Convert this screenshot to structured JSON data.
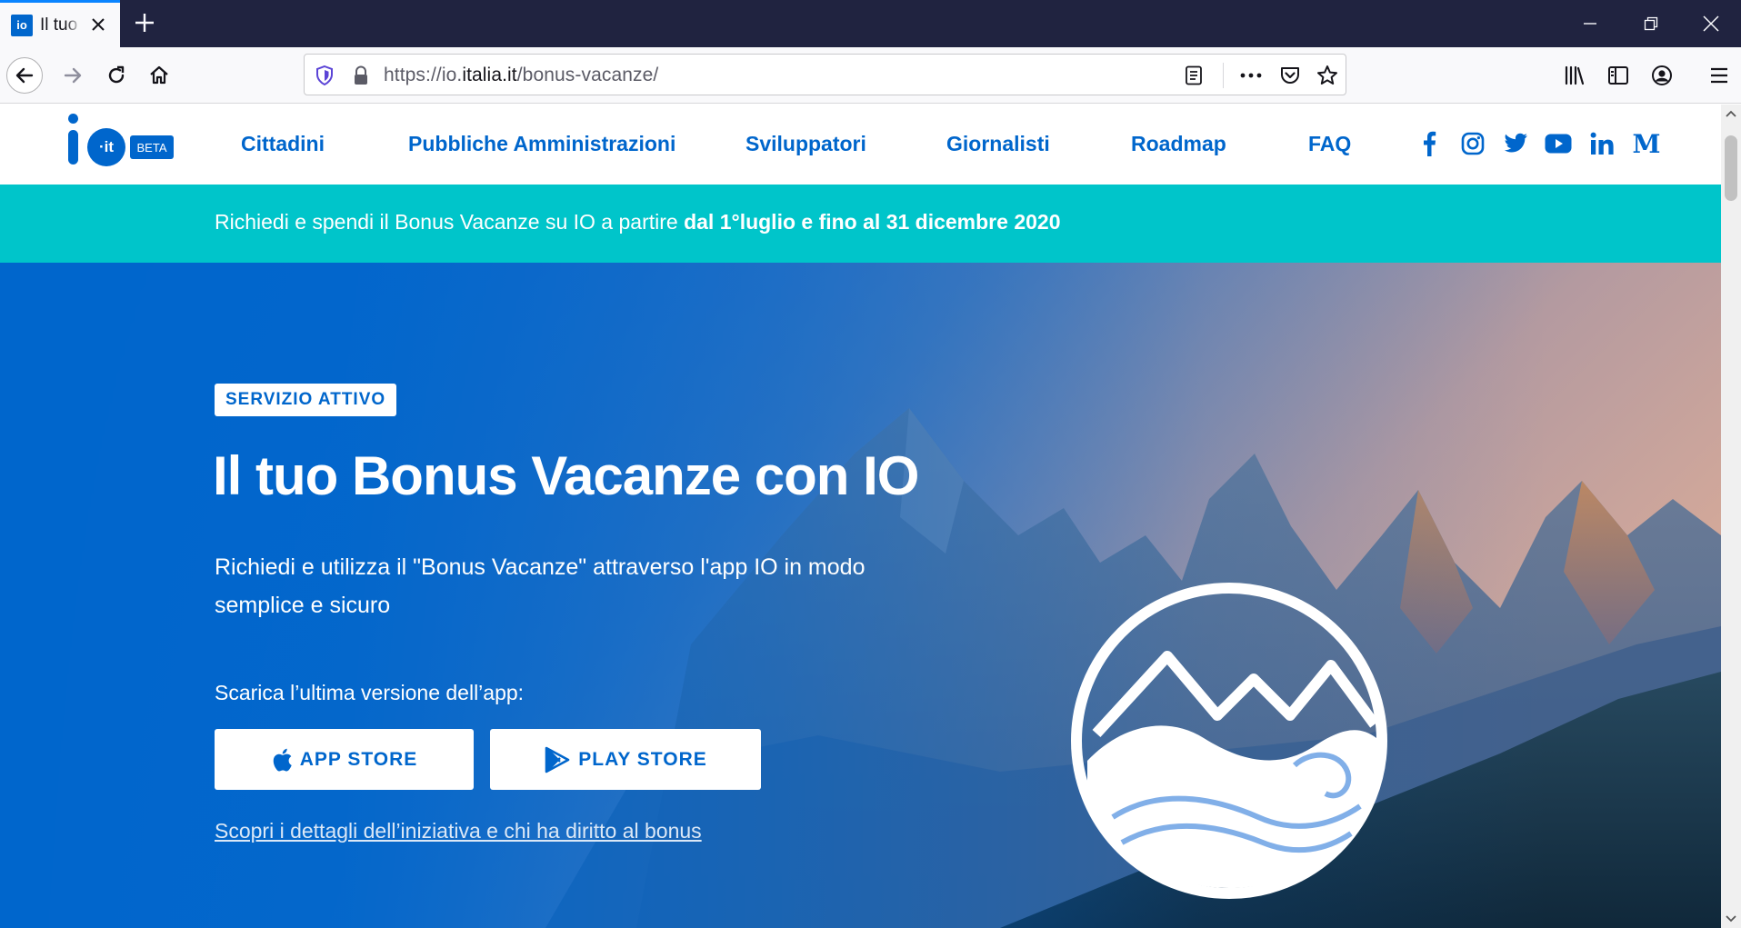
{
  "browser": {
    "tab_title": "Il tuo Bonus Vacanze con IO",
    "tab_favicon_text": "io",
    "url_prefix": "https://io.",
    "url_domain": "italia.it",
    "url_path": "/bonus-vacanze/"
  },
  "site": {
    "logo": {
      "letter": "i",
      "it_text": "·it",
      "beta_label": "BETA"
    },
    "nav": [
      {
        "label": "Cittadini"
      },
      {
        "label": "Pubbliche Amministrazioni"
      },
      {
        "label": "Sviluppatori"
      },
      {
        "label": "Giornalisti"
      },
      {
        "label": "Roadmap"
      },
      {
        "label": "FAQ"
      }
    ],
    "social_icons": [
      "facebook-icon",
      "instagram-icon",
      "twitter-icon",
      "youtube-icon",
      "linkedin-icon",
      "medium-icon"
    ],
    "medium_letter": "M",
    "linkedin_text": "in"
  },
  "announcement": {
    "text_regular": "Richiedi e spendi il Bonus Vacanze su IO a partire ",
    "text_bold": "dal 1°luglio e fino al 31 dicembre 2020"
  },
  "hero": {
    "badge": "SERVIZIO ATTIVO",
    "title": "Il tuo Bonus Vacanze con IO",
    "description": "Richiedi e utilizza il \"Bonus Vacanze\" attraverso l'app IO in modo semplice e sicuro",
    "download_label": "Scarica l’ultima versione dell’app:",
    "app_store_label": "APP STORE",
    "play_store_label": "PLAY STORE",
    "details_link": "Scopri i dettagli dell’iniziativa e chi ha diritto al bonus"
  },
  "colors": {
    "brand_blue": "#0066cc",
    "banner_teal": "#00c5ca",
    "tabstrip": "#202340",
    "toolbar": "#f9f9fb"
  }
}
